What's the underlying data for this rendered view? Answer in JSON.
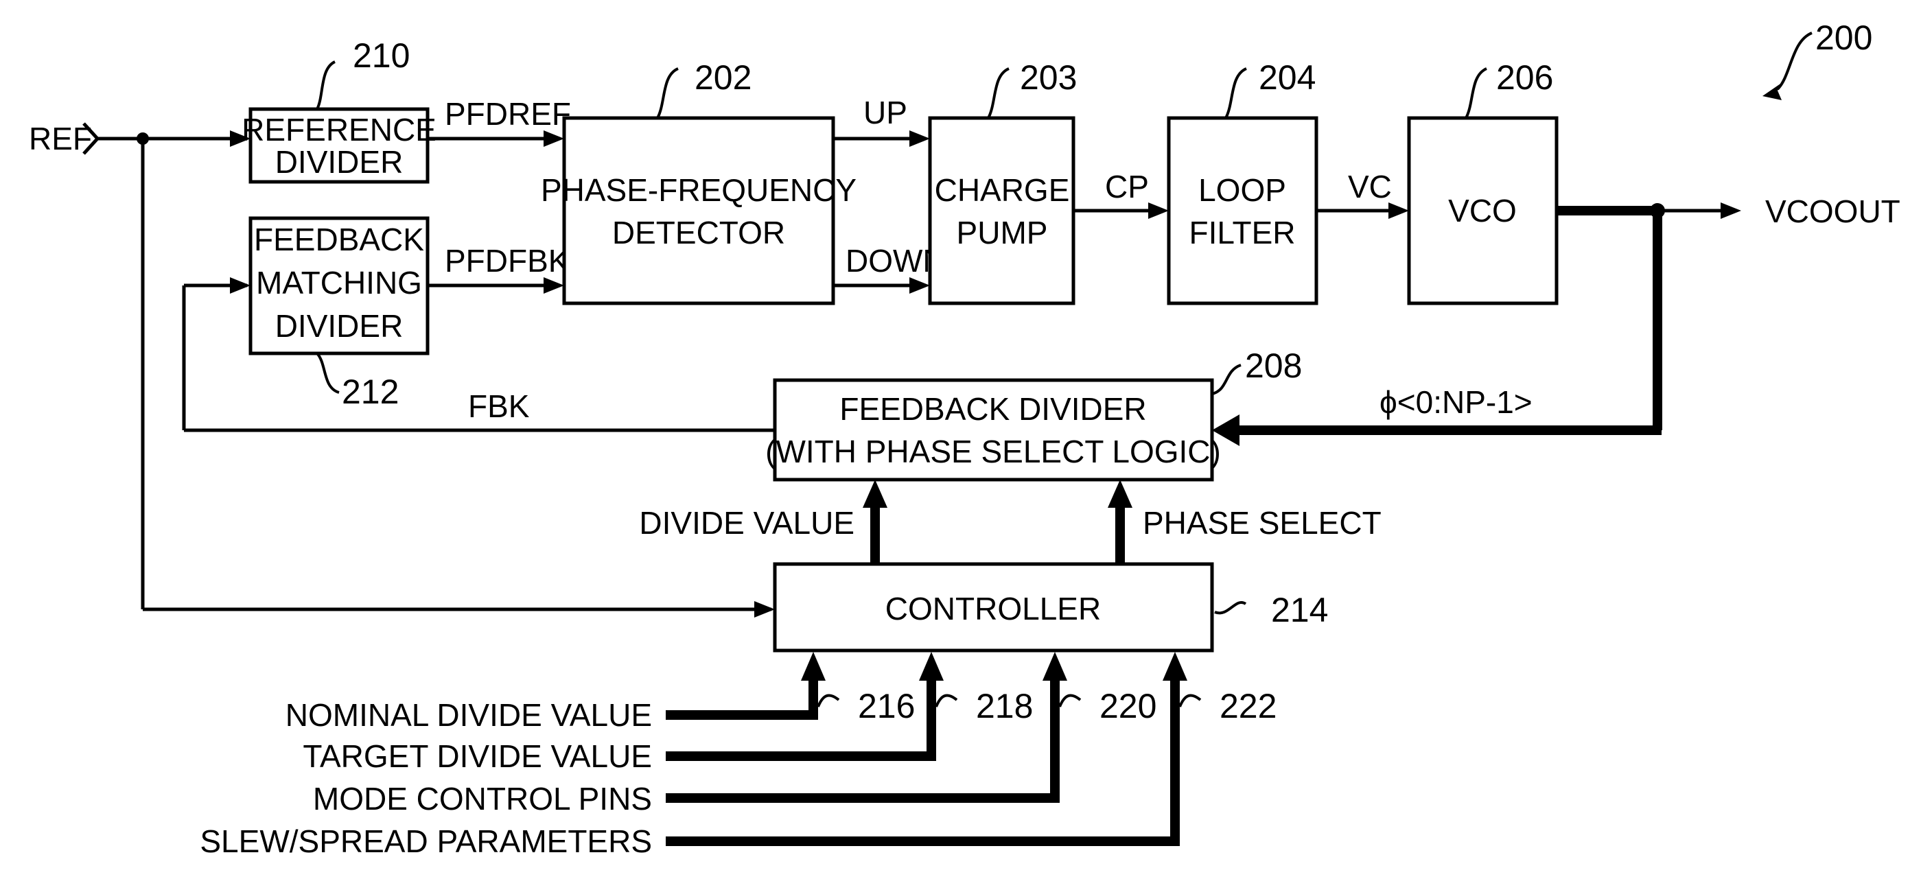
{
  "figure": {
    "number": "200",
    "blocks": {
      "reference_divider": {
        "ref": "210",
        "lines": [
          "REFERENCE",
          "DIVIDER"
        ]
      },
      "feedback_matching_divider": {
        "ref": "212",
        "lines": [
          "FEEDBACK",
          "MATCHING",
          "DIVIDER"
        ]
      },
      "pfd": {
        "ref": "202",
        "lines": [
          "PHASE-FREQUENCY",
          "DETECTOR"
        ]
      },
      "charge_pump": {
        "ref": "203",
        "lines": [
          "CHARGE",
          "PUMP"
        ]
      },
      "loop_filter": {
        "ref": "204",
        "lines": [
          "LOOP",
          "FILTER"
        ]
      },
      "vco": {
        "ref": "206",
        "lines": [
          "VCO"
        ]
      },
      "feedback_divider": {
        "ref": "208",
        "lines": [
          "FEEDBACK DIVIDER",
          "(WITH PHASE SELECT LOGIC)"
        ]
      },
      "controller": {
        "ref": "214",
        "lines": [
          "CONTROLLER"
        ]
      }
    },
    "signals": {
      "ref": "REF",
      "pfdref": "PFDREF",
      "pfdfbk": "PFDFBK",
      "up": "UP",
      "down": "DOWN",
      "cp": "CP",
      "vc": "VC",
      "vcoout": "VCOOUT",
      "phases": "ϕ<0:NP-1>",
      "fbk": "FBK",
      "divide_value": "DIVIDE VALUE",
      "phase_select": "PHASE SELECT"
    },
    "inputs": [
      {
        "label": "NOMINAL DIVIDE VALUE",
        "ref": "216"
      },
      {
        "label": "TARGET DIVIDE VALUE",
        "ref": "218"
      },
      {
        "label": "MODE CONTROL PINS",
        "ref": "220"
      },
      {
        "label": "SLEW/SPREAD PARAMETERS",
        "ref": "222"
      }
    ]
  }
}
